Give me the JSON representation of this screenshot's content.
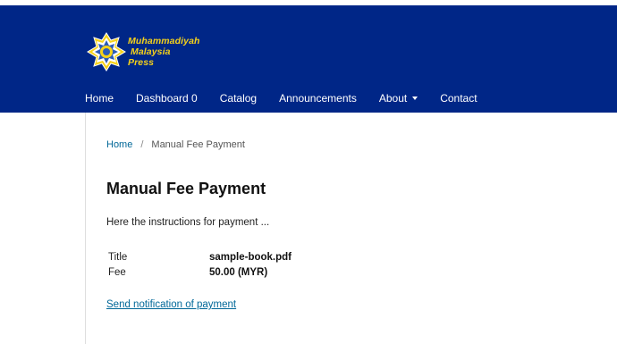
{
  "logo": {
    "line1": "Muhammadiyah",
    "line2": "Malaysia",
    "line3": "Press",
    "colors": {
      "gold": "#f6d21a",
      "blue": "#2c5bb8",
      "white": "#ffffff"
    }
  },
  "nav": {
    "items": [
      {
        "label": "Home"
      },
      {
        "label": "Dashboard 0"
      },
      {
        "label": "Catalog"
      },
      {
        "label": "Announcements"
      },
      {
        "label": "About"
      },
      {
        "label": "Contact"
      }
    ]
  },
  "breadcrumb": {
    "home": "Home",
    "separator": "/",
    "current": "Manual Fee Payment"
  },
  "page": {
    "title": "Manual Fee Payment",
    "instructions": "Here the instructions for payment ...",
    "details": [
      {
        "label": "Title",
        "value": "sample-book.pdf"
      },
      {
        "label": "Fee",
        "value": "50.00 (MYR)"
      }
    ],
    "notify_link": "Send notification of payment"
  },
  "colors": {
    "header_bg": "#002687",
    "link": "#006798"
  }
}
